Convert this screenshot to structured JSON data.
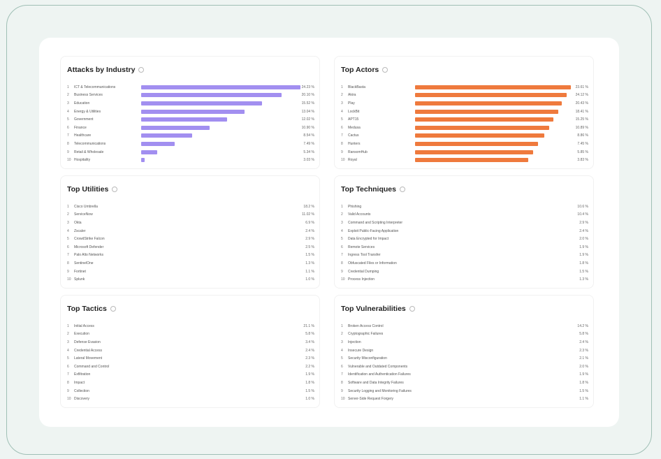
{
  "colors": {
    "industry_bar": "#a28ff0",
    "actors_bar": "#ef7a3d",
    "frame_border": "#9fbfb5"
  },
  "panels": {
    "industry": {
      "title": "Attacks by Industry",
      "items": [
        {
          "rank": "1",
          "name": "ICT & Telecommunications",
          "value": "24.23 %",
          "share": 1.0
        },
        {
          "rank": "2",
          "name": "Business Services",
          "value": "20.10 %",
          "share": 0.88
        },
        {
          "rank": "3",
          "name": "Education",
          "value": "15.52 %",
          "share": 0.76
        },
        {
          "rank": "4",
          "name": "Energy & Utilities",
          "value": "13.04 %",
          "share": 0.65
        },
        {
          "rank": "5",
          "name": "Government",
          "value": "12.02 %",
          "share": 0.54
        },
        {
          "rank": "6",
          "name": "Finance",
          "value": "10.90 %",
          "share": 0.43
        },
        {
          "rank": "7",
          "name": "Healthcare",
          "value": "8.54 %",
          "share": 0.32
        },
        {
          "rank": "8",
          "name": "Telecommunications",
          "value": "7.49 %",
          "share": 0.21
        },
        {
          "rank": "9",
          "name": "Retail & Wholesale",
          "value": "5.34 %",
          "share": 0.1
        },
        {
          "rank": "10",
          "name": "Hospitality",
          "value": "3.03 %",
          "share": 0.02
        }
      ]
    },
    "actors": {
      "title": "Top Actors",
      "items": [
        {
          "rank": "1",
          "name": "BlackBasta",
          "value": "23.61 %",
          "share": 0.98
        },
        {
          "rank": "2",
          "name": "Akira",
          "value": "24.12 %",
          "share": 0.95
        },
        {
          "rank": "3",
          "name": "Play",
          "value": "20.43 %",
          "share": 0.92
        },
        {
          "rank": "4",
          "name": "LockBit",
          "value": "18.41 %",
          "share": 0.9
        },
        {
          "rank": "5",
          "name": "APT15",
          "value": "15.25 %",
          "share": 0.87
        },
        {
          "rank": "6",
          "name": "Medusa",
          "value": "10.89 %",
          "share": 0.84
        },
        {
          "rank": "7",
          "name": "Cactus",
          "value": "8.86 %",
          "share": 0.81
        },
        {
          "rank": "8",
          "name": "Hunters",
          "value": "7.45 %",
          "share": 0.77
        },
        {
          "rank": "9",
          "name": "RansomHub",
          "value": "5.85 %",
          "share": 0.74
        },
        {
          "rank": "10",
          "name": "Royal",
          "value": "3.83 %",
          "share": 0.71
        }
      ]
    },
    "utilities": {
      "title": "Top Utilities",
      "items": [
        {
          "rank": "1",
          "name": "Cisco Umbrella",
          "value": "18.2 %"
        },
        {
          "rank": "2",
          "name": "ServiceNow",
          "value": "11.02 %"
        },
        {
          "rank": "3",
          "name": "Okta",
          "value": "6.9 %"
        },
        {
          "rank": "4",
          "name": "Zscaler",
          "value": "2.4 %"
        },
        {
          "rank": "5",
          "name": "CrowdStrike Falcon",
          "value": "2.9 %"
        },
        {
          "rank": "6",
          "name": "Microsoft Defender",
          "value": "2.5 %"
        },
        {
          "rank": "7",
          "name": "Palo Alto Networks",
          "value": "1.5 %"
        },
        {
          "rank": "8",
          "name": "SentinelOne",
          "value": "1.3 %"
        },
        {
          "rank": "9",
          "name": "Fortinet",
          "value": "1.1 %"
        },
        {
          "rank": "10",
          "name": "Splunk",
          "value": "1.0 %"
        }
      ]
    },
    "techniques": {
      "title": "Top Techniques",
      "items": [
        {
          "rank": "1",
          "name": "Phishing",
          "value": "10.6 %"
        },
        {
          "rank": "2",
          "name": "Valid Accounts",
          "value": "10.4 %"
        },
        {
          "rank": "3",
          "name": "Command and Scripting Interpreter",
          "value": "2.9 %"
        },
        {
          "rank": "4",
          "name": "Exploit Public-Facing Application",
          "value": "2.4 %"
        },
        {
          "rank": "5",
          "name": "Data Encrypted for Impact",
          "value": "2.0 %"
        },
        {
          "rank": "6",
          "name": "Remote Services",
          "value": "1.9 %"
        },
        {
          "rank": "7",
          "name": "Ingress Tool Transfer",
          "value": "1.9 %"
        },
        {
          "rank": "8",
          "name": "Obfuscated Files or Information",
          "value": "1.8 %"
        },
        {
          "rank": "9",
          "name": "Credential Dumping",
          "value": "1.5 %"
        },
        {
          "rank": "10",
          "name": "Process Injection",
          "value": "1.3 %"
        }
      ]
    },
    "tactics": {
      "title": "Top Tactics",
      "items": [
        {
          "rank": "1",
          "name": "Initial Access",
          "value": "21.1 %"
        },
        {
          "rank": "2",
          "name": "Execution",
          "value": "5.8 %"
        },
        {
          "rank": "3",
          "name": "Defense Evasion",
          "value": "3.4 %"
        },
        {
          "rank": "4",
          "name": "Credential Access",
          "value": "2.4 %"
        },
        {
          "rank": "5",
          "name": "Lateral Movement",
          "value": "2.3 %"
        },
        {
          "rank": "6",
          "name": "Command and Control",
          "value": "2.2 %"
        },
        {
          "rank": "7",
          "name": "Exfiltration",
          "value": "1.9 %"
        },
        {
          "rank": "8",
          "name": "Impact",
          "value": "1.8 %"
        },
        {
          "rank": "9",
          "name": "Collection",
          "value": "1.5 %"
        },
        {
          "rank": "10",
          "name": "Discovery",
          "value": "1.0 %"
        }
      ]
    },
    "vulnerabilities": {
      "title": "Top Vulnerabilities",
      "items": [
        {
          "rank": "1",
          "name": "Broken Access Control",
          "value": "14.2 %"
        },
        {
          "rank": "2",
          "name": "Cryptographic Failures",
          "value": "5.8 %"
        },
        {
          "rank": "3",
          "name": "Injection",
          "value": "2.4 %"
        },
        {
          "rank": "4",
          "name": "Insecure Design",
          "value": "2.3 %"
        },
        {
          "rank": "5",
          "name": "Security Misconfiguration",
          "value": "2.1 %"
        },
        {
          "rank": "6",
          "name": "Vulnerable and Outdated Components",
          "value": "2.0 %"
        },
        {
          "rank": "7",
          "name": "Identification and Authentication Failures",
          "value": "1.9 %"
        },
        {
          "rank": "8",
          "name": "Software and Data Integrity Failures",
          "value": "1.8 %"
        },
        {
          "rank": "9",
          "name": "Security Logging and Monitoring Failures",
          "value": "1.5 %"
        },
        {
          "rank": "10",
          "name": "Server-Side Request Forgery",
          "value": "1.1 %"
        }
      ]
    }
  }
}
